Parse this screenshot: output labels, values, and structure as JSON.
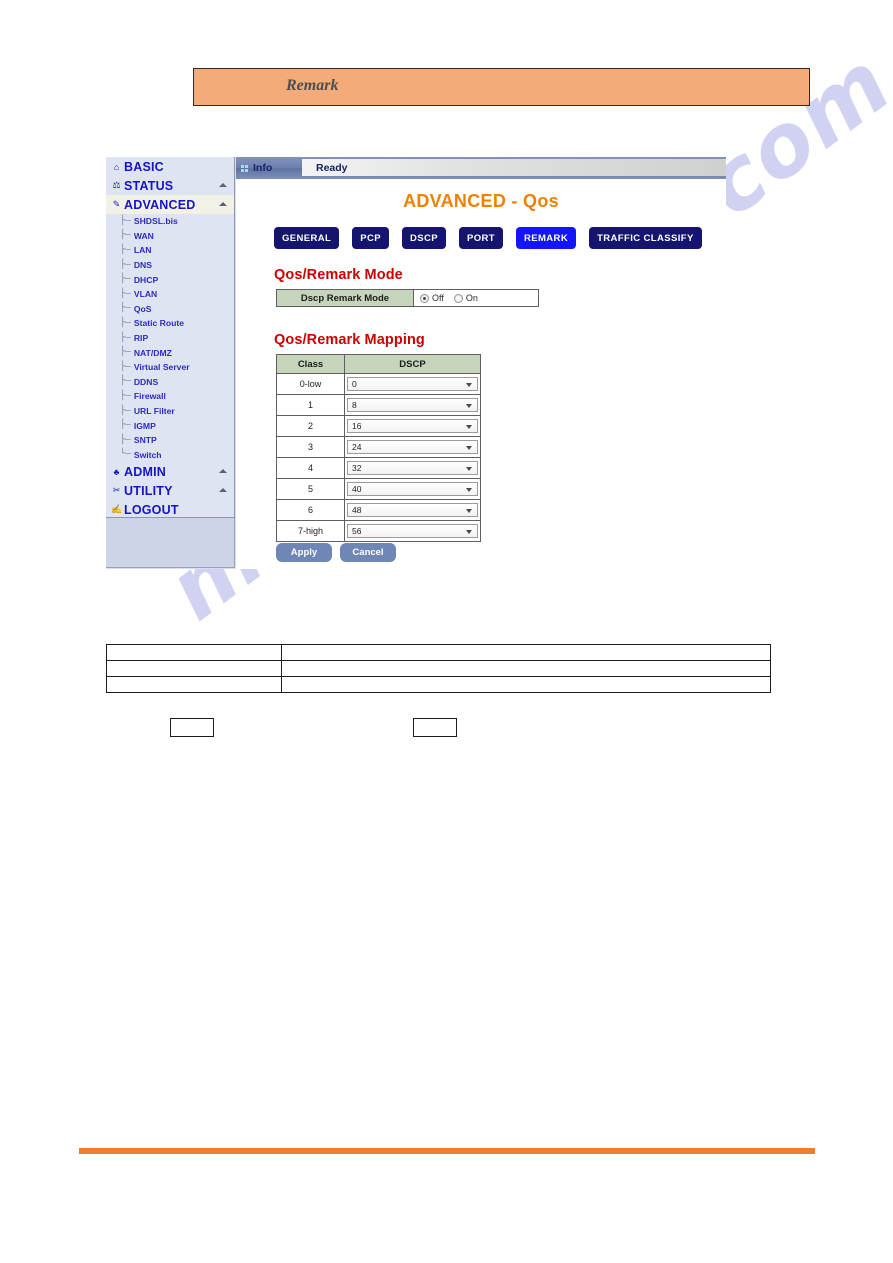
{
  "banner": {
    "label": "Remark"
  },
  "watermark": {
    "text": "manualshive.com"
  },
  "sidebar": {
    "top_items": [
      {
        "label": "BASIC",
        "icon": "house-icon",
        "glyph": "⌂",
        "has_arrow": false,
        "active": false
      },
      {
        "label": "STATUS",
        "icon": "gauge-icon",
        "glyph": "⚖",
        "has_arrow": true,
        "active": false
      },
      {
        "label": "ADVANCED",
        "icon": "pencil-icon",
        "glyph": "✎",
        "has_arrow": true,
        "active": true
      }
    ],
    "sub_items": [
      {
        "label": "SHDSL.bis"
      },
      {
        "label": "WAN"
      },
      {
        "label": "LAN"
      },
      {
        "label": "DNS"
      },
      {
        "label": "DHCP"
      },
      {
        "label": "VLAN"
      },
      {
        "label": "QoS"
      },
      {
        "label": "Static Route"
      },
      {
        "label": "RIP"
      },
      {
        "label": "NAT/DMZ"
      },
      {
        "label": "Virtual Server"
      },
      {
        "label": "DDNS"
      },
      {
        "label": "Firewall"
      },
      {
        "label": "URL Filter"
      },
      {
        "label": "IGMP"
      },
      {
        "label": "SNTP"
      },
      {
        "label": "Switch"
      }
    ],
    "bottom_items": [
      {
        "label": "ADMIN",
        "icon": "tools-icon",
        "glyph": "♣",
        "has_arrow": true
      },
      {
        "label": "UTILITY",
        "icon": "wrench-icon",
        "glyph": "✂",
        "has_arrow": true
      },
      {
        "label": "LOGOUT",
        "icon": "exit-icon",
        "glyph": "✍",
        "has_arrow": false
      }
    ]
  },
  "infobar": {
    "label": "Info",
    "status": "Ready"
  },
  "page": {
    "title": "ADVANCED - Qos"
  },
  "tabs": [
    {
      "label": "GENERAL",
      "active": false
    },
    {
      "label": "PCP",
      "active": false
    },
    {
      "label": "DSCP",
      "active": false
    },
    {
      "label": "PORT",
      "active": false
    },
    {
      "label": "REMARK",
      "active": true
    },
    {
      "label": "TRAFFIC CLASSIFY",
      "active": false
    }
  ],
  "mode_section": {
    "title": "Qos/Remark Mode",
    "row_label": "Dscp Remark Mode",
    "radios": [
      {
        "label": "Off",
        "checked": true
      },
      {
        "label": "On",
        "checked": false
      }
    ]
  },
  "mapping_section": {
    "title": "Qos/Remark Mapping",
    "headers": [
      "Class",
      "DSCP"
    ],
    "rows": [
      {
        "class": "0-low",
        "dscp": "0"
      },
      {
        "class": "1",
        "dscp": "8"
      },
      {
        "class": "2",
        "dscp": "16"
      },
      {
        "class": "3",
        "dscp": "24"
      },
      {
        "class": "4",
        "dscp": "32"
      },
      {
        "class": "5",
        "dscp": "40"
      },
      {
        "class": "6",
        "dscp": "48"
      },
      {
        "class": "7-high",
        "dscp": "56"
      }
    ]
  },
  "actions": [
    {
      "label": "Apply"
    },
    {
      "label": "Cancel"
    }
  ],
  "description_table": {
    "rows": [
      {
        "key": "",
        "value": ""
      },
      {
        "key": "",
        "value": ""
      },
      {
        "key": "",
        "value": ""
      }
    ]
  },
  "mini_boxes": [
    {
      "text": ""
    },
    {
      "text": ""
    }
  ],
  "colors": {
    "banner_bg": "#f3ab79",
    "title_orange": "#f08000",
    "section_red": "#cc0000",
    "tab_navy": "#151570",
    "tab_active_blue": "#1414ff",
    "table_header_green": "#c5d4bb",
    "button_blue": "#6f87b4",
    "sidebar_bg": "#dfe4f2",
    "rule_orange": "#ee7e2d",
    "watermark": "#c9c9ef"
  }
}
